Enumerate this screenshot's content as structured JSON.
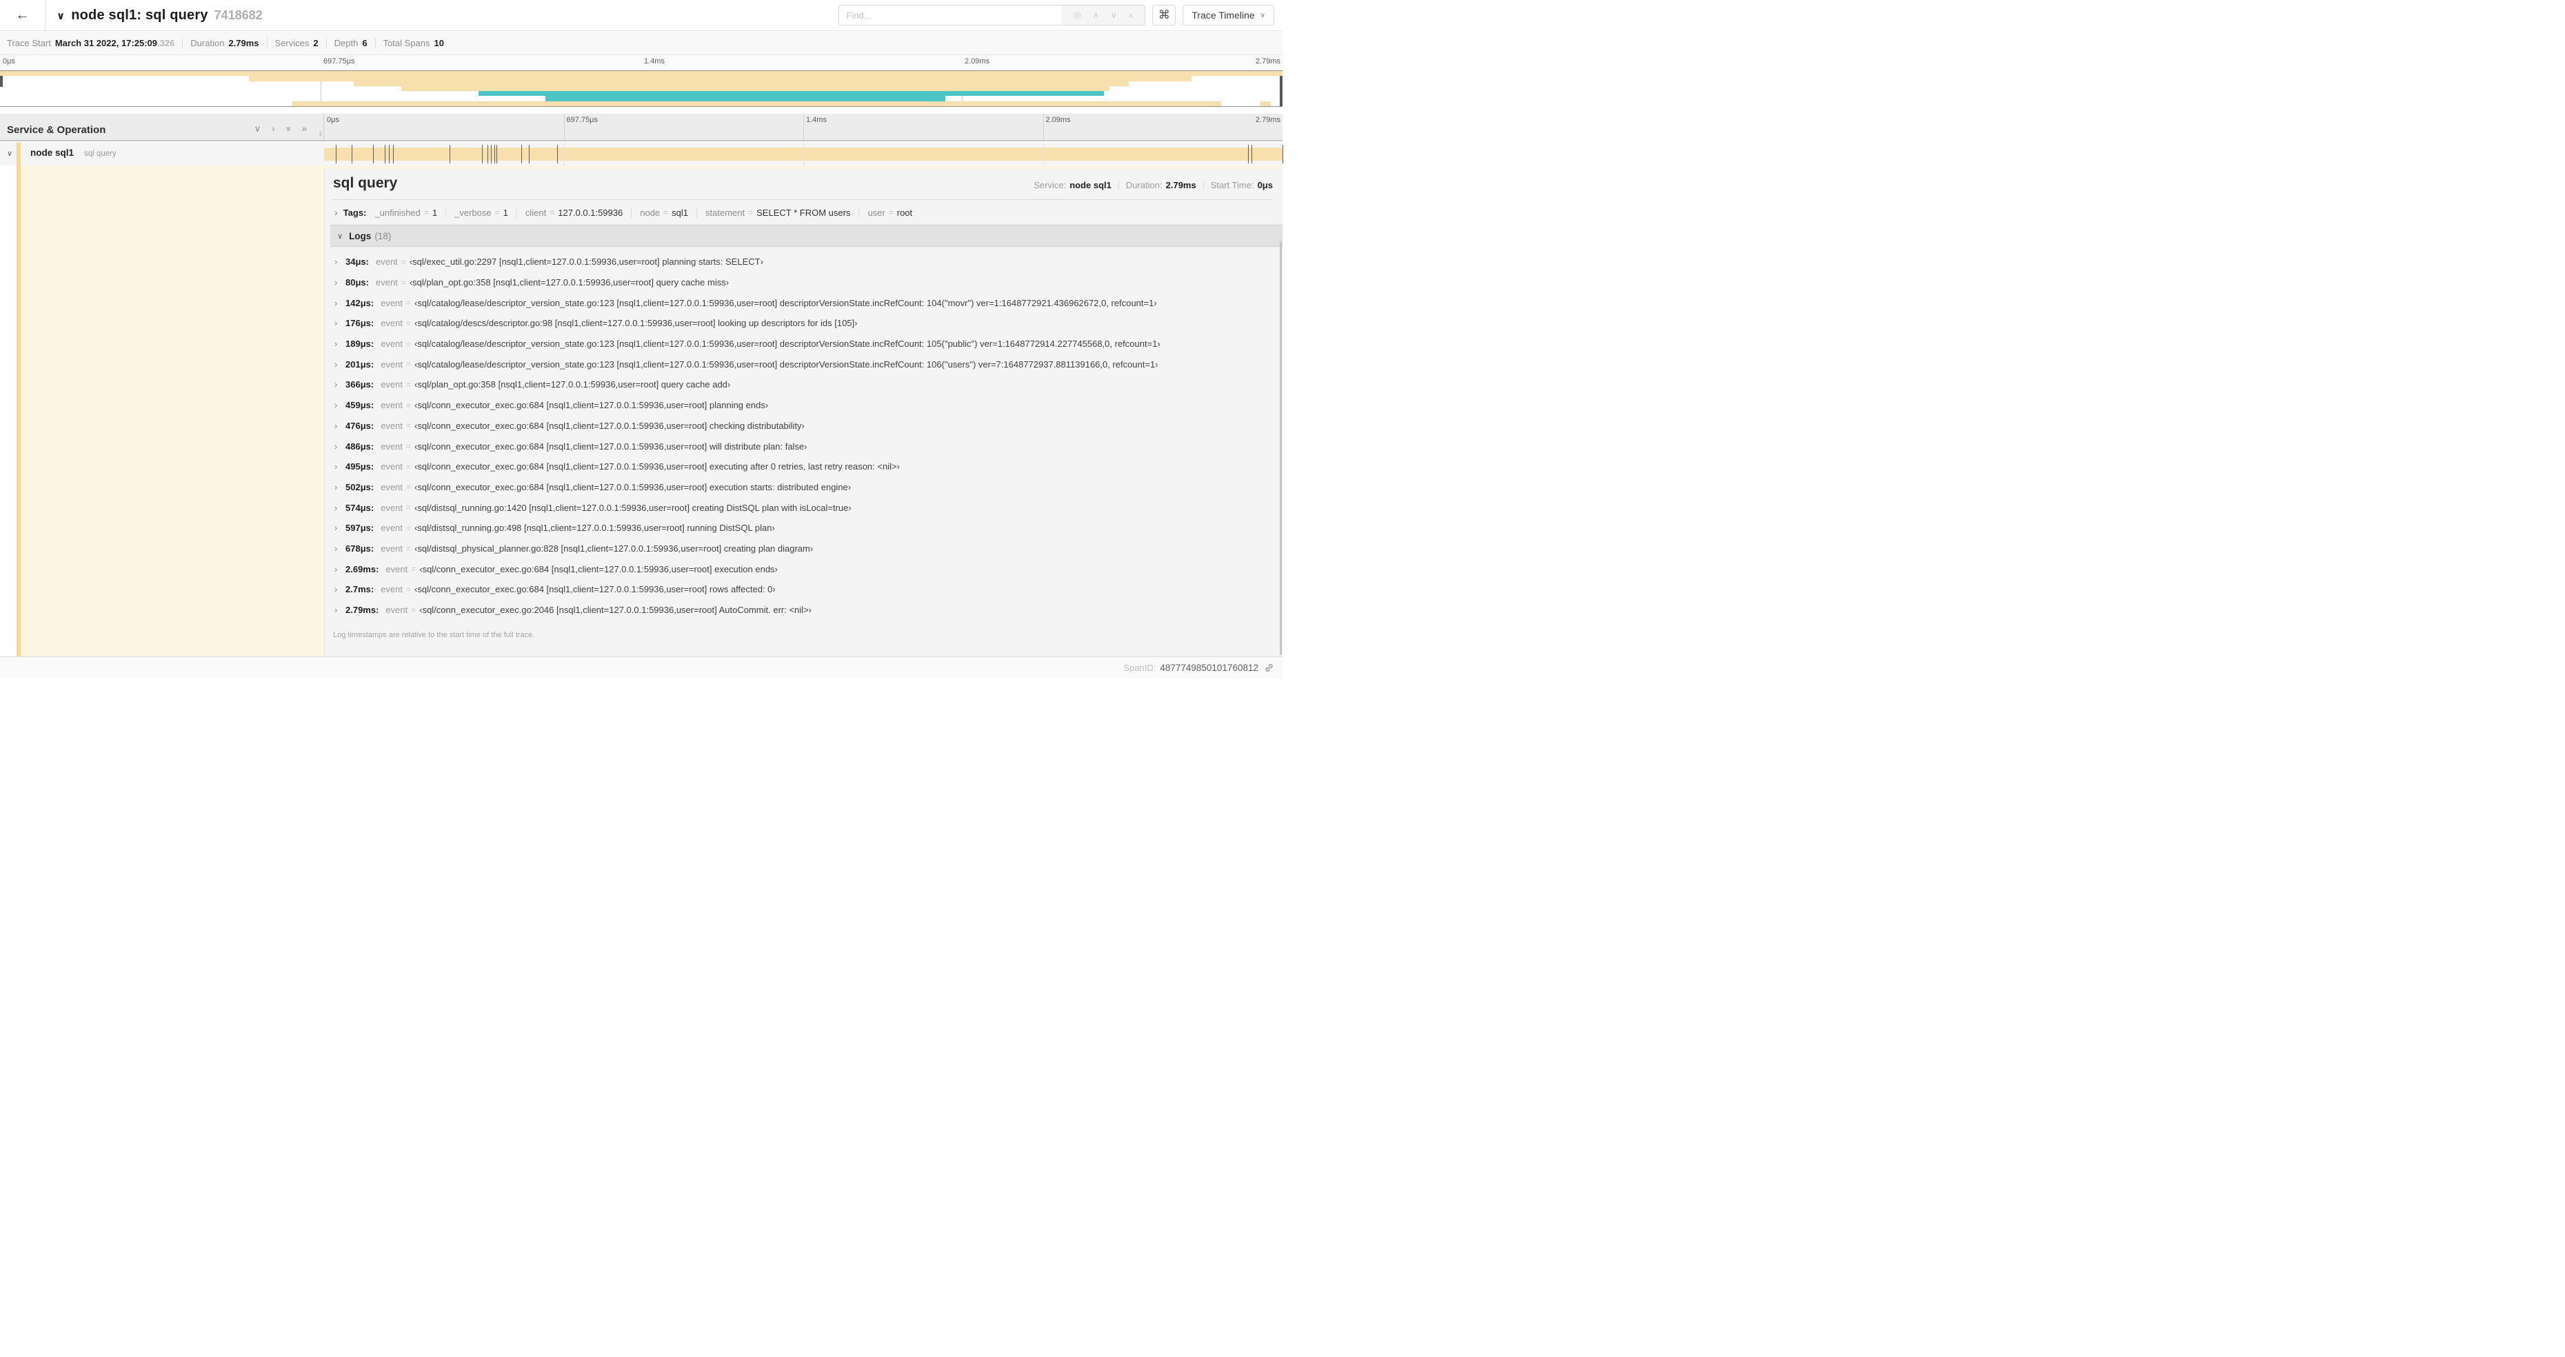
{
  "icons": {
    "back": "←",
    "title_chevron": "∨",
    "locate": "◎",
    "prev_match": "∧",
    "next_match": "∨",
    "clear": "×",
    "shortcut": "⌘",
    "dropdown_chevron": "∨",
    "collapse_one": "∨",
    "expand_one": "›",
    "collapse_all": "»",
    "expand_all": "»",
    "row_chevron": "∨",
    "tags_chevron": "›",
    "logs_chevron": "∨",
    "log_chevron": "›",
    "grip": "‖"
  },
  "header": {
    "title": "node sql1: sql query",
    "trace_id": "7418682",
    "find_placeholder": "Find...",
    "view_button": "Trace Timeline"
  },
  "summary": {
    "items": [
      {
        "label": "Trace Start",
        "value": "March 31 2022, 17:25:09",
        "suffix": ".326"
      },
      {
        "label": "Duration",
        "value": "2.79ms"
      },
      {
        "label": "Services",
        "value": "2"
      },
      {
        "label": "Depth",
        "value": "6"
      },
      {
        "label": "Total Spans",
        "value": "10"
      }
    ]
  },
  "timeline": {
    "total_us": 2790,
    "ticks": [
      "0μs",
      "697.75μs",
      "1.4ms",
      "2.09ms",
      "2.79ms"
    ]
  },
  "minimap": {
    "colors": {
      "tan": "#f8dfae",
      "teal": "#4ac4c5"
    },
    "bars": [
      {
        "row": 0,
        "left": 0,
        "width": 100,
        "color": "tan"
      },
      {
        "row": 1,
        "left": 19.4,
        "width": 73.5,
        "color": "tan"
      },
      {
        "row": 2,
        "left": 27.6,
        "width": 60.4,
        "color": "tan"
      },
      {
        "row": 3,
        "left": 31.3,
        "width": 55.2,
        "color": "tan"
      },
      {
        "row": 4,
        "left": 37.3,
        "width": 48.8,
        "color": "teal"
      },
      {
        "row": 5,
        "left": 42.5,
        "width": 31.2,
        "color": "teal"
      },
      {
        "row": 6,
        "left": 22.8,
        "width": 72.4,
        "color": "tan"
      },
      {
        "row": 6,
        "left": 98.3,
        "width": 0.8,
        "color": "tan"
      }
    ]
  },
  "span_table": {
    "header": "Service & Operation",
    "row": {
      "service": "node sql1",
      "operation": "sql query"
    },
    "log_marks_us": [
      34,
      80,
      142,
      176,
      189,
      201,
      366,
      459,
      476,
      486,
      495,
      502,
      574,
      597,
      678,
      2690,
      2700,
      2790
    ]
  },
  "detail": {
    "title": "sql query",
    "meta": [
      {
        "label": "Service:",
        "value": "node sql1"
      },
      {
        "label": "Duration:",
        "value": "2.79ms"
      },
      {
        "label": "Start Time:",
        "value": "0μs"
      }
    ],
    "tags_label": "Tags:",
    "tags": [
      {
        "key": "_unfinished",
        "value": "1"
      },
      {
        "key": "_verbose",
        "value": "1"
      },
      {
        "key": "client",
        "value": "127.0.0.1:59936"
      },
      {
        "key": "node",
        "value": "sql1"
      },
      {
        "key": "statement",
        "value": "SELECT * FROM users"
      },
      {
        "key": "user",
        "value": "root"
      }
    ],
    "logs_title": "Logs",
    "logs_count": "(18)",
    "log_key": "event",
    "logs": [
      {
        "time": "34μs:",
        "text": "sql/exec_util.go:2297 [nsql1,client=127.0.0.1:59936,user=root] planning starts: SELECT"
      },
      {
        "time": "80μs:",
        "text": "sql/plan_opt.go:358 [nsql1,client=127.0.0.1:59936,user=root] query cache miss"
      },
      {
        "time": "142μs:",
        "text": "sql/catalog/lease/descriptor_version_state.go:123 [nsql1,client=127.0.0.1:59936,user=root] descriptorVersionState.incRefCount: 104(\"movr\") ver=1:1648772921.436962672,0, refcount=1"
      },
      {
        "time": "176μs:",
        "text": "sql/catalog/descs/descriptor.go:98 [nsql1,client=127.0.0.1:59936,user=root] looking up descriptors for ids [105]"
      },
      {
        "time": "189μs:",
        "text": "sql/catalog/lease/descriptor_version_state.go:123 [nsql1,client=127.0.0.1:59936,user=root] descriptorVersionState.incRefCount: 105(\"public\") ver=1:1648772914.227745568,0, refcount=1"
      },
      {
        "time": "201μs:",
        "text": "sql/catalog/lease/descriptor_version_state.go:123 [nsql1,client=127.0.0.1:59936,user=root] descriptorVersionState.incRefCount: 106(\"users\") ver=7:1648772937.881139166,0, refcount=1"
      },
      {
        "time": "366μs:",
        "text": "sql/plan_opt.go:358 [nsql1,client=127.0.0.1:59936,user=root] query cache add"
      },
      {
        "time": "459μs:",
        "text": "sql/conn_executor_exec.go:684 [nsql1,client=127.0.0.1:59936,user=root] planning ends"
      },
      {
        "time": "476μs:",
        "text": "sql/conn_executor_exec.go:684 [nsql1,client=127.0.0.1:59936,user=root] checking distributability"
      },
      {
        "time": "486μs:",
        "text": "sql/conn_executor_exec.go:684 [nsql1,client=127.0.0.1:59936,user=root] will distribute plan: false"
      },
      {
        "time": "495μs:",
        "text": "sql/conn_executor_exec.go:684 [nsql1,client=127.0.0.1:59936,user=root] executing after 0 retries, last retry reason: <nil>"
      },
      {
        "time": "502μs:",
        "text": "sql/conn_executor_exec.go:684 [nsql1,client=127.0.0.1:59936,user=root] execution starts: distributed engine"
      },
      {
        "time": "574μs:",
        "text": "sql/distsql_running.go:1420 [nsql1,client=127.0.0.1:59936,user=root] creating DistSQL plan with isLocal=true"
      },
      {
        "time": "597μs:",
        "text": "sql/distsql_running.go:498 [nsql1,client=127.0.0.1:59936,user=root] running DistSQL plan"
      },
      {
        "time": "678μs:",
        "text": "sql/distsql_physical_planner.go:828 [nsql1,client=127.0.0.1:59936,user=root] creating plan diagram"
      },
      {
        "time": "2.69ms:",
        "text": "sql/conn_executor_exec.go:684 [nsql1,client=127.0.0.1:59936,user=root] execution ends"
      },
      {
        "time": "2.7ms:",
        "text": "sql/conn_executor_exec.go:684 [nsql1,client=127.0.0.1:59936,user=root] rows affected: 0"
      },
      {
        "time": "2.79ms:",
        "text": "sql/conn_executor_exec.go:2046 [nsql1,client=127.0.0.1:59936,user=root] AutoCommit. err: <nil>"
      }
    ],
    "logs_note": "Log timestamps are relative to the start time of the full trace.",
    "spanid_label": "SpanID:",
    "spanid_value": "4877749850101760812"
  }
}
